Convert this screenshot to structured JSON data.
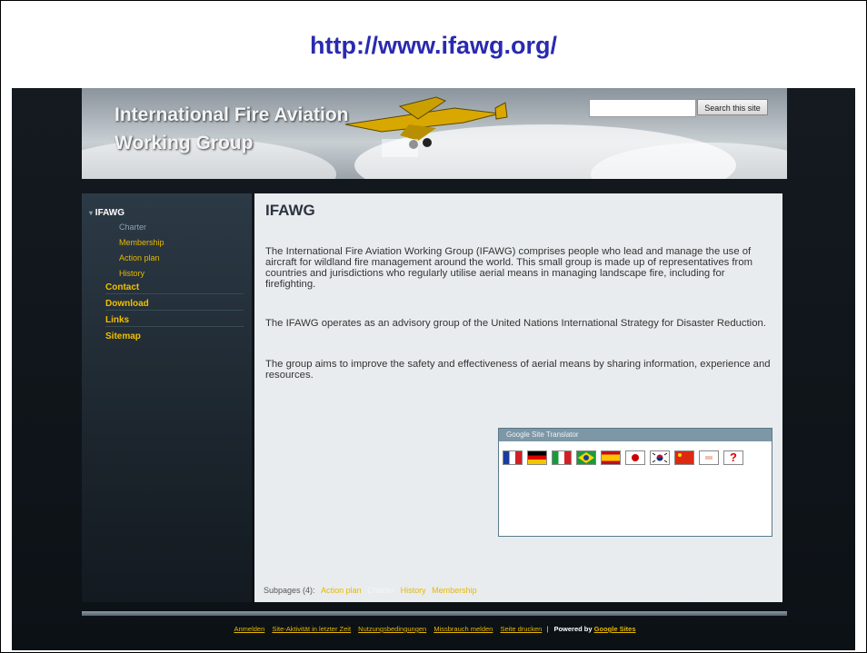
{
  "slide": {
    "title": "http://www.ifawg.org/"
  },
  "header": {
    "site_name_line1": "International Fire Aviation",
    "site_name_line2": "Working Group",
    "search_button": "Search this site",
    "search_value": ""
  },
  "sidebar": {
    "top_item": "IFAWG",
    "sub_items": [
      {
        "label": "Charter"
      },
      {
        "label": "Membership"
      },
      {
        "label": "Action plan"
      },
      {
        "label": "History"
      }
    ],
    "main_items": [
      {
        "label": "Contact"
      },
      {
        "label": "Download"
      },
      {
        "label": "Links"
      },
      {
        "label": "Sitemap"
      }
    ]
  },
  "main": {
    "heading": "IFAWG",
    "paragraphs": [
      "The International Fire Aviation Working Group (IFAWG) comprises people who lead and manage the use of aircraft for wildland fire management around the world.  This small group is made up of representatives from countries and jurisdictions who regularly utilise aerial means in managing landscape fire, including for firefighting.",
      "The IFAWG operates as an advisory group of the United Nations International Strategy for Disaster Reduction.",
      "The group aims to improve the safety and effectiveness of aerial means by sharing information, experience and resources."
    ]
  },
  "translator": {
    "title": "Google Site Translator",
    "flags": [
      "french-flag-icon",
      "german-flag-icon",
      "italian-flag-icon",
      "brazil-flag-icon",
      "spanish-flag-icon",
      "japan-flag-icon",
      "korea-flag-icon",
      "china-flag-icon",
      "unknown-flag-icon",
      "help-icon"
    ],
    "help_glyph": "?"
  },
  "subpages": {
    "label": "Subpages (4):",
    "links": [
      "Action plan",
      "Charter",
      "History",
      "Membership"
    ]
  },
  "footer": {
    "links": [
      "Anmelden",
      "Site-Aktivität in letzter Zeit",
      "Nutzungsbedingungen",
      "Missbrauch melden",
      "Seite drucken"
    ],
    "separator": "|",
    "powered": "Powered by",
    "powered_link": "Google Sites"
  },
  "colors": {
    "link_yellow": "#e6b800",
    "slide_title": "#2a2ab0",
    "content_bg": "#e9ecee"
  }
}
